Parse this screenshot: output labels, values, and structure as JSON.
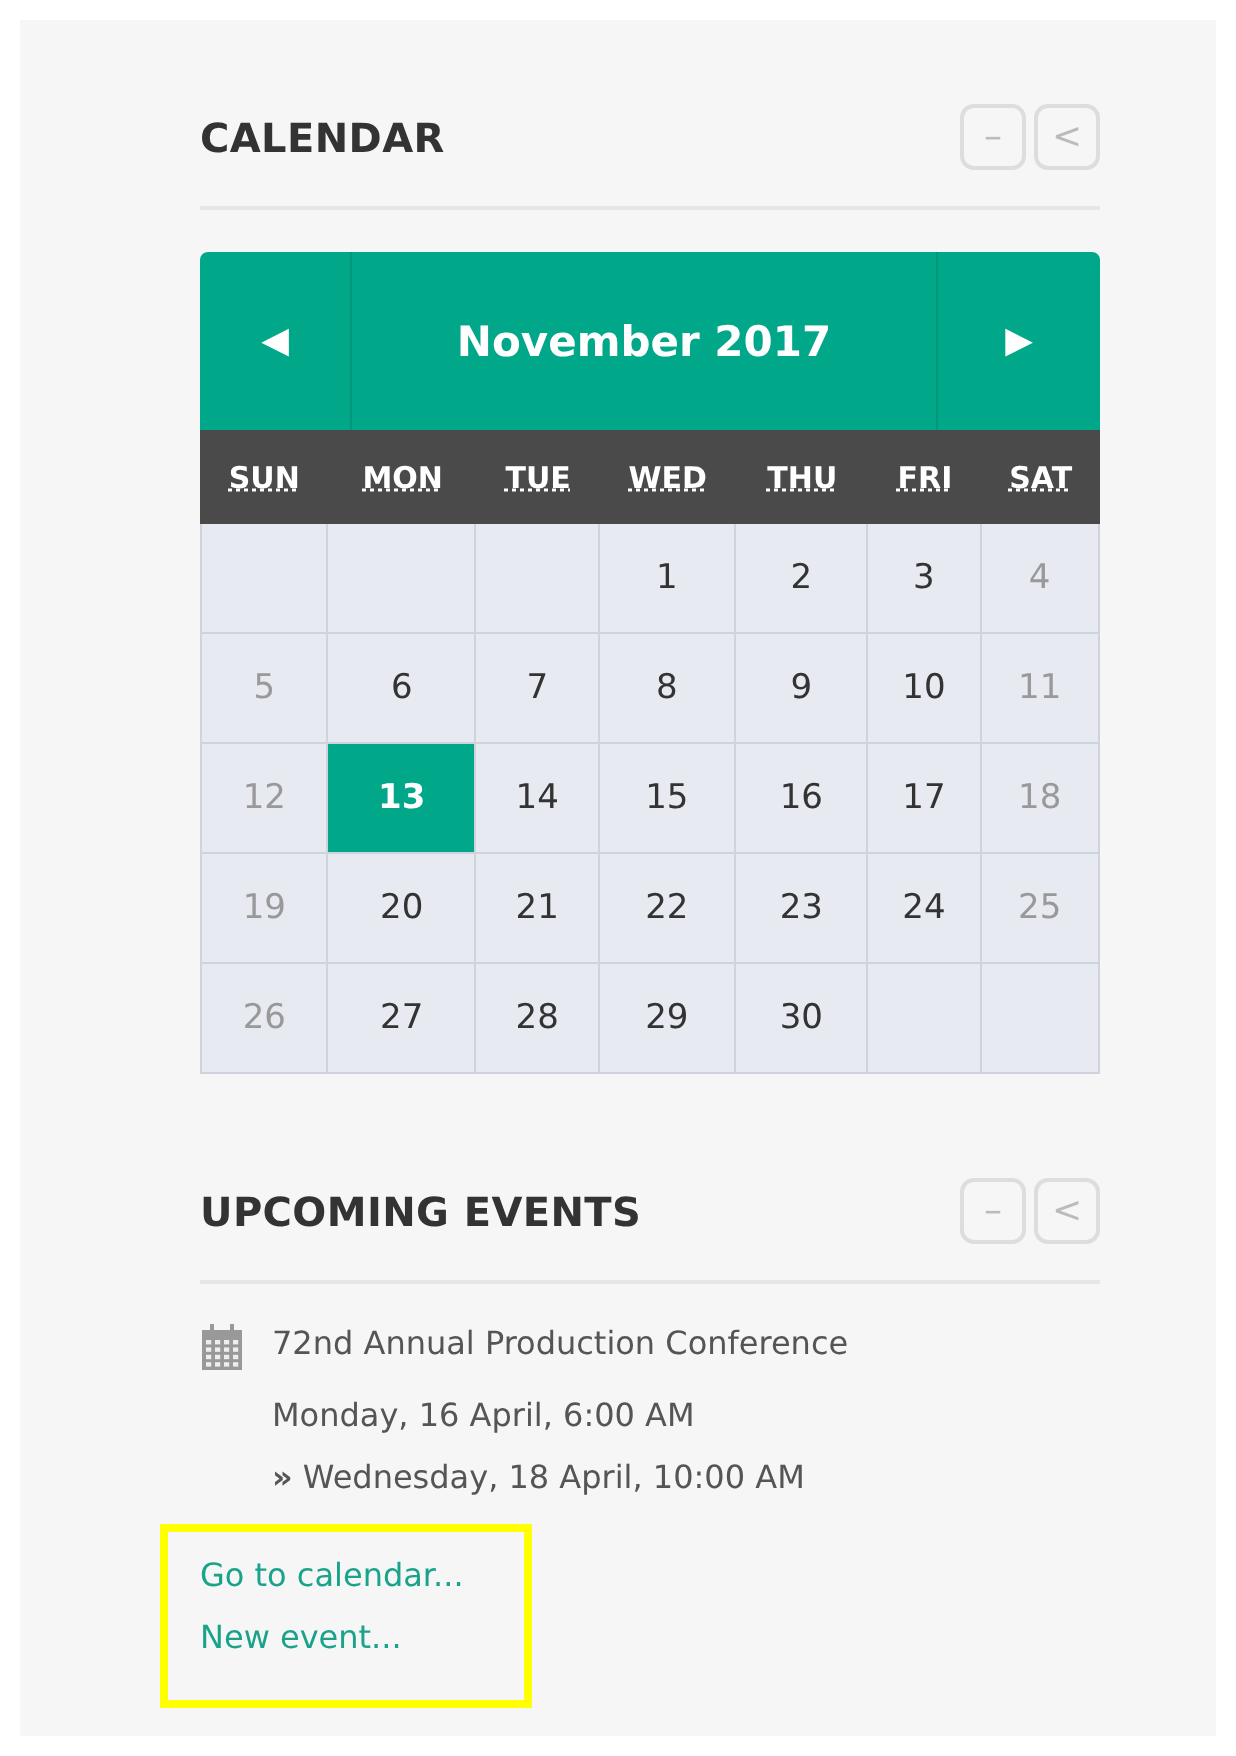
{
  "calendar_block": {
    "title": "CALENDAR",
    "controls": [
      "–",
      "<"
    ]
  },
  "calendar": {
    "prev": "◀",
    "month": "November 2017",
    "next": "▶",
    "weekdays": [
      "SUN",
      "MON",
      "TUE",
      "WED",
      "THU",
      "FRI",
      "SAT"
    ],
    "weeks": [
      [
        {
          "kind": "blank"
        },
        {
          "kind": "blank"
        },
        {
          "kind": "blank"
        },
        {
          "kind": "day",
          "day": "1",
          "weekend": false,
          "today": false
        },
        {
          "kind": "day",
          "day": "2",
          "weekend": false,
          "today": false
        },
        {
          "kind": "day",
          "day": "3",
          "weekend": false,
          "today": false
        },
        {
          "kind": "day",
          "day": "4",
          "weekend": true,
          "today": false
        }
      ],
      [
        {
          "kind": "day",
          "day": "5",
          "weekend": true,
          "today": false
        },
        {
          "kind": "day",
          "day": "6",
          "weekend": false,
          "today": false
        },
        {
          "kind": "day",
          "day": "7",
          "weekend": false,
          "today": false
        },
        {
          "kind": "day",
          "day": "8",
          "weekend": false,
          "today": false
        },
        {
          "kind": "day",
          "day": "9",
          "weekend": false,
          "today": false
        },
        {
          "kind": "day",
          "day": "10",
          "weekend": false,
          "today": false
        },
        {
          "kind": "day",
          "day": "11",
          "weekend": true,
          "today": false
        }
      ],
      [
        {
          "kind": "day",
          "day": "12",
          "weekend": true,
          "today": false
        },
        {
          "kind": "day",
          "day": "13",
          "weekend": false,
          "today": true
        },
        {
          "kind": "day",
          "day": "14",
          "weekend": false,
          "today": false
        },
        {
          "kind": "day",
          "day": "15",
          "weekend": false,
          "today": false
        },
        {
          "kind": "day",
          "day": "16",
          "weekend": false,
          "today": false
        },
        {
          "kind": "day",
          "day": "17",
          "weekend": false,
          "today": false
        },
        {
          "kind": "day",
          "day": "18",
          "weekend": true,
          "today": false
        }
      ],
      [
        {
          "kind": "day",
          "day": "19",
          "weekend": true,
          "today": false
        },
        {
          "kind": "day",
          "day": "20",
          "weekend": false,
          "today": false
        },
        {
          "kind": "day",
          "day": "21",
          "weekend": false,
          "today": false
        },
        {
          "kind": "day",
          "day": "22",
          "weekend": false,
          "today": false
        },
        {
          "kind": "day",
          "day": "23",
          "weekend": false,
          "today": false
        },
        {
          "kind": "day",
          "day": "24",
          "weekend": false,
          "today": false
        },
        {
          "kind": "day",
          "day": "25",
          "weekend": true,
          "today": false
        }
      ],
      [
        {
          "kind": "day",
          "day": "26",
          "weekend": true,
          "today": false
        },
        {
          "kind": "day",
          "day": "27",
          "weekend": false,
          "today": false
        },
        {
          "kind": "day",
          "day": "28",
          "weekend": false,
          "today": false
        },
        {
          "kind": "day",
          "day": "29",
          "weekend": false,
          "today": false
        },
        {
          "kind": "day",
          "day": "30",
          "weekend": false,
          "today": false
        },
        {
          "kind": "blank"
        },
        {
          "kind": "blank"
        }
      ]
    ]
  },
  "events_block": {
    "title": "UPCOMING EVENTS",
    "controls": [
      "–",
      "<"
    ]
  },
  "events": [
    {
      "title": "72nd Annual Production Conference",
      "start": "Monday, 16 April, 6:00 AM",
      "end": "**»** Wednesday, 18 April, 10:00 AM"
    }
  ],
  "links": [
    "Go to calendar...",
    "New event..."
  ]
}
